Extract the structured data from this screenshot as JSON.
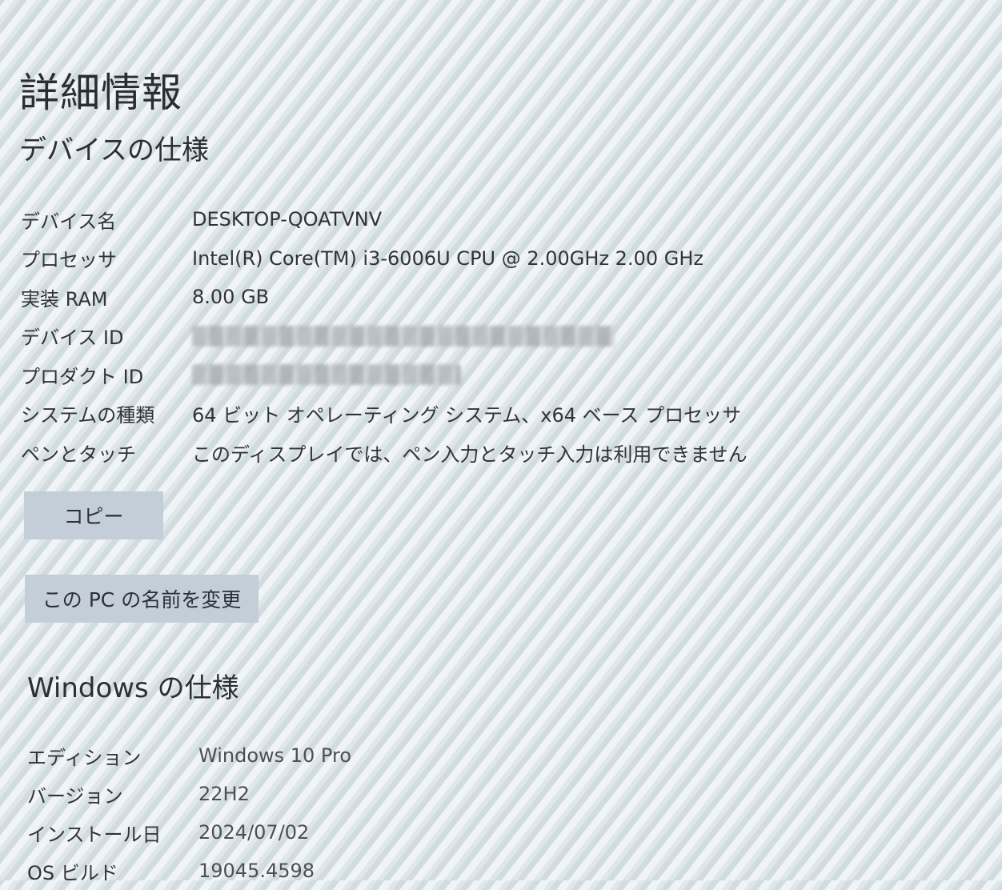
{
  "page": {
    "title": "詳細情報"
  },
  "device_specs": {
    "heading": "デバイスの仕様",
    "rows": [
      {
        "label": "デバイス名",
        "value": "DESKTOP-QOATVNV"
      },
      {
        "label": "プロセッサ",
        "value": "Intel(R) Core(TM) i3-6006U CPU @ 2.00GHz   2.00 GHz"
      },
      {
        "label": "実装 RAM",
        "value": "8.00 GB"
      },
      {
        "label": "デバイス ID",
        "value": ""
      },
      {
        "label": "プロダクト ID",
        "value": ""
      },
      {
        "label": "システムの種類",
        "value": "64 ビット オペレーティング システム、x64 ベース プロセッサ"
      },
      {
        "label": "ペンとタッチ",
        "value": "このディスプレイでは、ペン入力とタッチ入力は利用できません"
      }
    ],
    "copy_button": "コピー",
    "rename_button": "この PC の名前を変更"
  },
  "windows_specs": {
    "heading": "Windows の仕様",
    "rows": [
      {
        "label": "エディション",
        "value": "Windows 10 Pro"
      },
      {
        "label": "バージョン",
        "value": "22H2"
      },
      {
        "label": "インストール日",
        "value": "2024/07/02"
      },
      {
        "label": "OS ビルド",
        "value": "19045.4598"
      }
    ]
  }
}
